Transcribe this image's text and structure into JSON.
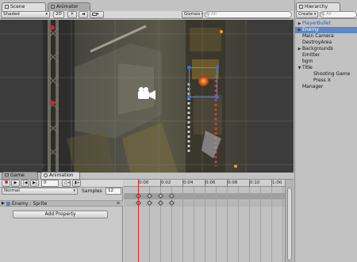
{
  "scene": {
    "tab_label": "Scene",
    "animator_tab_label": "Animator",
    "shading_mode": "Shaded",
    "mode_2d": "2D",
    "gizmos_label": "Gizmos",
    "search_placeholder": "All"
  },
  "hierarchy": {
    "tab_label": "Hierarchy",
    "create_label": "Create",
    "search_placeholder": "All",
    "items": [
      {
        "label": "PlayerBullet",
        "indent": 0,
        "arrow": "▶",
        "style": "blue"
      },
      {
        "label": "Enemy",
        "indent": 0,
        "arrow": "▶",
        "style": "selected"
      },
      {
        "label": "Main Camera",
        "indent": 0,
        "arrow": "",
        "style": "normal"
      },
      {
        "label": "DestroyArea",
        "indent": 0,
        "arrow": "",
        "style": "normal"
      },
      {
        "label": "Backgrounds",
        "indent": 0,
        "arrow": "▶",
        "style": "normal"
      },
      {
        "label": "Emitter",
        "indent": 0,
        "arrow": "",
        "style": "normal"
      },
      {
        "label": "bgm",
        "indent": 0,
        "arrow": "",
        "style": "normal"
      },
      {
        "label": "Title",
        "indent": 0,
        "arrow": "▼",
        "style": "normal"
      },
      {
        "label": "Shooting Game",
        "indent": 1,
        "arrow": "",
        "style": "normal"
      },
      {
        "label": "Press X",
        "indent": 1,
        "arrow": "",
        "style": "normal"
      },
      {
        "label": "Manager",
        "indent": 0,
        "arrow": "",
        "style": "normal"
      }
    ]
  },
  "bottom_tabs": {
    "game_label": "Game",
    "animation_label": "Animation"
  },
  "animation": {
    "frame_value": "0",
    "wrap_mode": "Normal",
    "samples_label": "Samples",
    "samples_value": "12",
    "timeline_ticks": [
      "0:00",
      "0:02",
      "0:04",
      "0:06",
      "0:08",
      "0:10",
      "1:00"
    ],
    "property_name": "Enemy : Sprite",
    "add_property_label": "Add Property",
    "record_color": "#c43030",
    "playhead_color": "#e02020"
  },
  "icons": {
    "record": "record-icon",
    "play": "play-icon",
    "prev_key": "prev-key-icon",
    "next_key": "next-key-icon",
    "audio": "speaker-icon",
    "sun": "sun-icon",
    "image": "image-icon"
  }
}
